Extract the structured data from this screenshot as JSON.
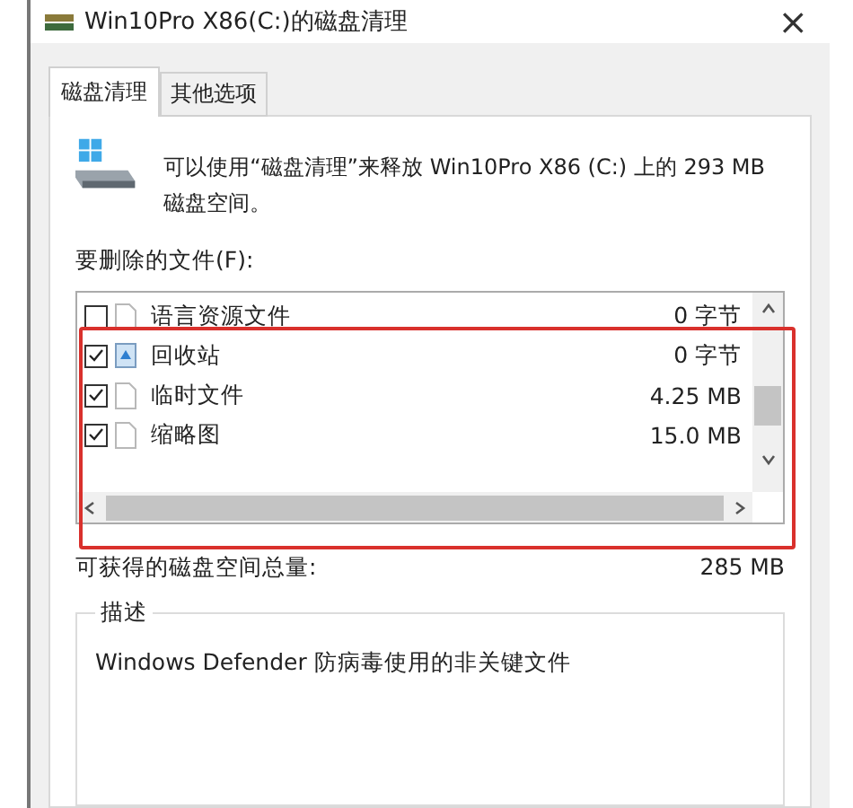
{
  "window": {
    "title": "Win10Pro X86(C:)的磁盘清理",
    "close": "×"
  },
  "tabs": [
    {
      "label": "磁盘清理",
      "selected": true
    },
    {
      "label": "其他选项",
      "selected": false
    }
  ],
  "intro": "可以使用“磁盘清理”来释放 Win10Pro X86 (C:) 上的 293 MB 磁盘空间。",
  "files_label": "要删除的文件(F):",
  "files": [
    {
      "name": "语言资源文件",
      "size": "0 字节",
      "checked": false,
      "kind": "document"
    },
    {
      "name": "回收站",
      "size": "0 字节",
      "checked": true,
      "kind": "recycle"
    },
    {
      "name": "临时文件",
      "size": "4.25 MB",
      "checked": true,
      "kind": "document"
    },
    {
      "name": "缩略图",
      "size": "15.0 MB",
      "checked": true,
      "kind": "document"
    }
  ],
  "total": {
    "label": "可获得的磁盘空间总量:",
    "value": "285 MB"
  },
  "description": {
    "title": "描述",
    "text": "Windows Defender 防病毒使用的非关键文件"
  }
}
